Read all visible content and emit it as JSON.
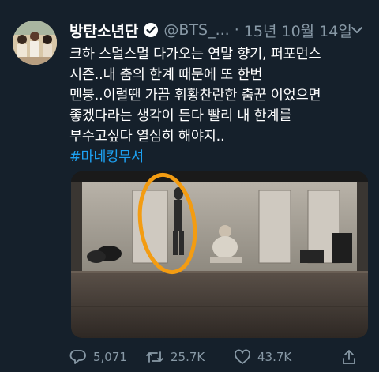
{
  "tweet": {
    "display_name": "방탄소년단",
    "handle": "@BTS_...",
    "separator": "·",
    "date": "15년 10월 14일",
    "text_lines": [
      "크하 스멀스멀 다가오는 연말 향기, 퍼포먼스",
      "시즌..내 춤의 한계 때문에 또 한번",
      "멘붕..이럴땐 가끔 휘황찬란한 춤꾼 이었으면",
      "좋겠다라는 생각이 든다 빨리 내 한계를",
      "부수고싶다 열심히 해야지.."
    ],
    "hashtag": "#마네킹무셔"
  },
  "actions": {
    "reply_count": "5,071",
    "retweet_count": "25.7K",
    "like_count": "43.7K"
  },
  "colors": {
    "background": "#15202b",
    "text": "#ffffff",
    "muted": "#8899a6",
    "link": "#1da1f2",
    "annotation_circle": "#f39c12"
  },
  "icons": [
    "verified-badge-icon",
    "chevron-down-icon",
    "reply-icon",
    "retweet-icon",
    "like-icon",
    "share-icon"
  ]
}
